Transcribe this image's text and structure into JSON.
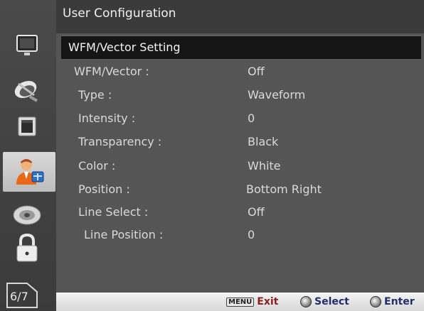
{
  "header": {
    "title": "User Configuration"
  },
  "section": {
    "title": "WFM/Vector Setting"
  },
  "settings": [
    {
      "label": "WFM/Vector :",
      "value": "Off"
    },
    {
      "label": "Type :",
      "value": "Waveform"
    },
    {
      "label": "Intensity :",
      "value": "0"
    },
    {
      "label": "Transparency :",
      "value": "Black"
    },
    {
      "label": "Color :",
      "value": "White"
    },
    {
      "label": "Position :",
      "value": "Bottom Right"
    },
    {
      "label": "Line Select :",
      "value": "Off"
    },
    {
      "label": "Line Position :",
      "value": "0"
    }
  ],
  "sidebar": {
    "icons": [
      "monitor-icon",
      "satellite-dish-icon",
      "display-screen-icon",
      "user-config-icon",
      "disc-icon",
      "lock-icon"
    ],
    "active_index": 3,
    "page_indicator": "6/7"
  },
  "footer": {
    "menu_key": "MENU",
    "exit_label": "Exit",
    "select_label": "Select",
    "enter_label": "Enter"
  }
}
